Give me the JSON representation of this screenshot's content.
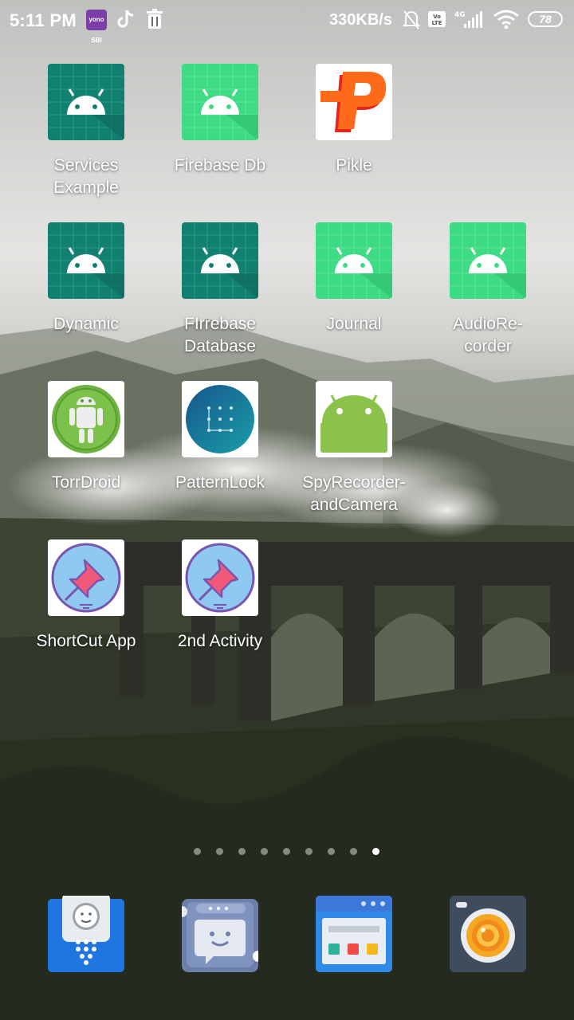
{
  "status_bar": {
    "time": "5:11 PM",
    "yono_label": "yono SBI",
    "net_speed": "330KB/s",
    "network": "4G",
    "battery": "78"
  },
  "apps": [
    {
      "label": "Services\nExample",
      "icon": "android-icon-dark"
    },
    {
      "label": "Firebase Db",
      "icon": "android-icon-light"
    },
    {
      "label": "Pikle",
      "icon": "pikle-p-icon"
    },
    {
      "label": "Dynamic",
      "icon": "android-icon-dark"
    },
    {
      "label": "FIrrebase\nDatabase",
      "icon": "android-icon-dark"
    },
    {
      "label": "Journal",
      "icon": "android-icon-light"
    },
    {
      "label": "AudioRe-\ncorder",
      "icon": "android-icon-light"
    },
    {
      "label": "TorrDroid",
      "icon": "torrdroid-icon"
    },
    {
      "label": "PatternLock",
      "icon": "pattern-lock-icon"
    },
    {
      "label": "SpyRecorder-\nandCamera",
      "icon": "android-robot-icon"
    },
    {
      "label": "ShortCut App",
      "icon": "pin-icon"
    },
    {
      "label": "2nd Activity",
      "icon": "pin-icon"
    }
  ],
  "page_indicator": {
    "count": 9,
    "active": 9
  },
  "dock": [
    {
      "icon": "contacts-icon"
    },
    {
      "icon": "messaging-icon"
    },
    {
      "icon": "browser-icon"
    },
    {
      "icon": "camera-icon"
    }
  ],
  "colors": {
    "android_dark": "#128071",
    "android_light": "#3ddc84",
    "dock_blue": "#1f76e0"
  }
}
